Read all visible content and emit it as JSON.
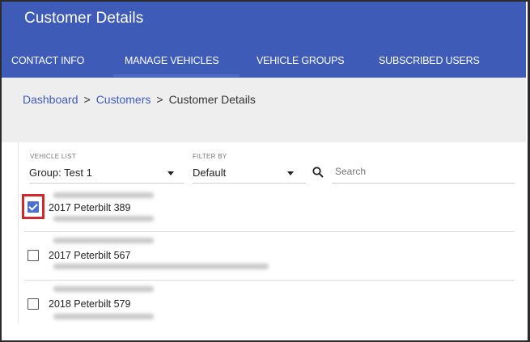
{
  "header": {
    "title": "Customer Details",
    "tabs": [
      {
        "label": "CONTACT INFO"
      },
      {
        "label": "MANAGE VEHICLES"
      },
      {
        "label": "VEHICLE GROUPS"
      },
      {
        "label": "SUBSCRIBED USERS"
      }
    ],
    "active_tab": "MANAGE VEHICLES"
  },
  "breadcrumb": {
    "items": [
      "Dashboard",
      "Customers",
      "Customer Details"
    ],
    "separator": ">"
  },
  "filters": {
    "vehicle_list": {
      "label": "VEHICLE LIST",
      "value": "Group: Test 1"
    },
    "filter_by": {
      "label": "FILTER BY",
      "value": "Default"
    },
    "search": {
      "placeholder": "Search"
    }
  },
  "vehicles": [
    {
      "name": "2017 Peterbilt 389",
      "checked": true
    },
    {
      "name": "2017 Peterbilt 567",
      "checked": false
    },
    {
      "name": "2018 Peterbilt 579",
      "checked": false
    }
  ],
  "colors": {
    "header_bg": "#3e5bb8",
    "accent": "#3e5bb8",
    "checkbox_checked": "#4a6fd0",
    "highlight": "#d6262b"
  }
}
